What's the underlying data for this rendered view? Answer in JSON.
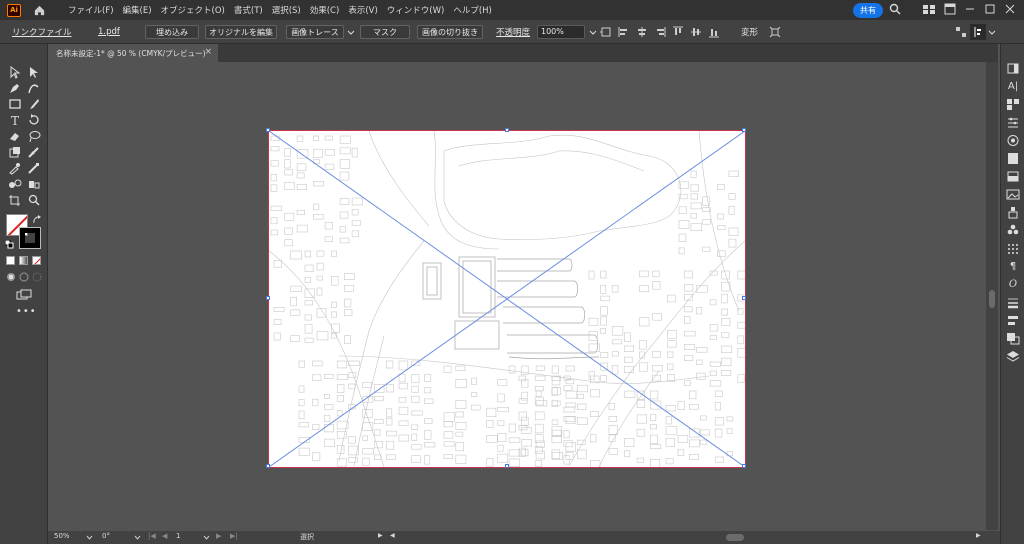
{
  "app": {
    "logo": "Ai"
  },
  "menus": [
    "ファイル(F)",
    "編集(E)",
    "オブジェクト(O)",
    "書式(T)",
    "選択(S)",
    "効果(C)",
    "表示(V)",
    "ウィンドウ(W)",
    "ヘルプ(H)"
  ],
  "share_label": "共有",
  "control": {
    "link_panel": "リンクファイル",
    "file_name": "1.pdf",
    "embed": "埋め込み",
    "edit_original": "オリジナルを編集",
    "image_trace": "画像トレース",
    "mask": "マスク",
    "crop_image": "画像の切り抜き",
    "opacity_label": "不透明度",
    "opacity_value": "100%",
    "transform": "変形"
  },
  "document_tab": {
    "title": "名称未設定-1* @ 50 % (CMYK/プレビュー)",
    "close": "×"
  },
  "status": {
    "zoom": "50%",
    "rotate": "0°",
    "artboard_nav": "1",
    "tool_name": "選択"
  },
  "icons": [
    "home-icon",
    "search-icon",
    "arrange-icon",
    "panel-icon",
    "selection-tool-icon",
    "direct-selection-icon",
    "pen-icon",
    "curvature-icon",
    "rectangle-icon",
    "brush-icon",
    "type-icon",
    "rotate-icon",
    "eraser-icon",
    "lasso-icon",
    "fill-icon",
    "eyedropper-icon",
    "blend-icon",
    "width-icon",
    "shape-builder-icon",
    "hand-icon",
    "zoom-icon",
    "color-icon",
    "char-icon",
    "properties-icon",
    "layers-icon"
  ],
  "colors": {
    "accent": "#1473e6",
    "artboard_border": "#c8324a",
    "selection": "#4a78d8"
  }
}
